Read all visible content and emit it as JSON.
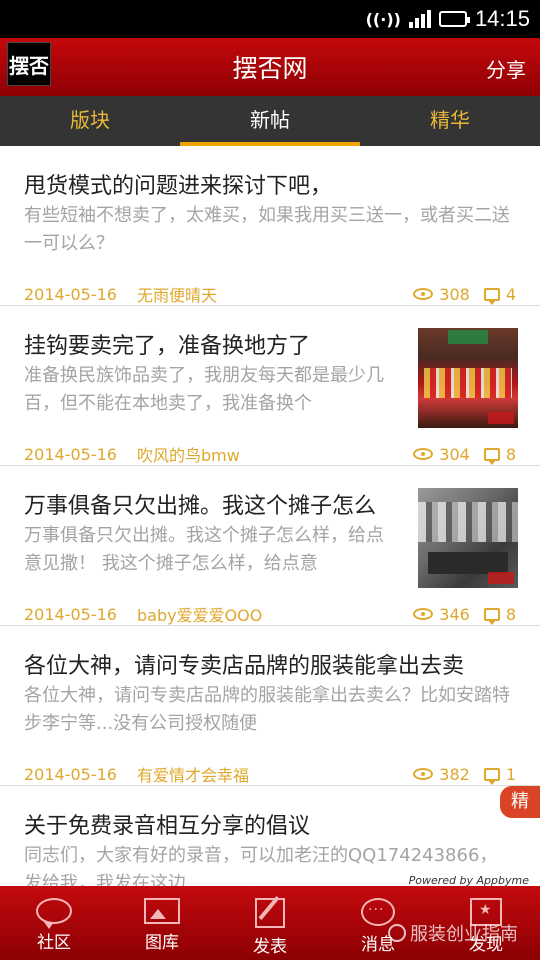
{
  "status_bar": {
    "time": "14:15",
    "vibrate_icon": "vibrate-icon",
    "signal_icon": "signal-icon",
    "battery_icon": "battery-icon"
  },
  "header": {
    "logo_text": "摆否",
    "title": "摆否网",
    "share_label": "分享"
  },
  "tabs": [
    {
      "label": "版块"
    },
    {
      "label": "新帖",
      "active": true
    },
    {
      "label": "精华"
    }
  ],
  "posts": [
    {
      "title": "甩货模式的问题进来探讨下吧，",
      "summary": "有些短袖不想卖了，太难买，如果我用买三送一，或者买二送一可以么？",
      "date": "2014-05-16",
      "author": "无雨便晴天",
      "views": "308",
      "replies": "4"
    },
    {
      "title": "挂钩要卖完了，准备换地方了",
      "summary": "准备换民族饰品卖了，我朋友每天都是最少几百，但不能在本地卖了，我准备换个",
      "date": "2014-05-16",
      "author": "吹风的鸟bmw",
      "views": "304",
      "replies": "8"
    },
    {
      "title": "万事俱备只欠出摊。我这个摊子怎么",
      "summary": "万事俱备只欠出摊。我这个摊子怎么样，给点意见撒！ 我这个摊子怎么样，给点意",
      "date": "2014-05-16",
      "author": "baby爱爱爱OOO",
      "views": "346",
      "replies": "8"
    },
    {
      "title": "各位大神，请问专卖店品牌的服装能拿出去卖",
      "summary": "各位大神，请问专卖店品牌的服装能拿出去卖么？比如安踏特步李宁等...没有公司授权随便",
      "date": "2014-05-16",
      "author": "有爱情才会幸福",
      "views": "382",
      "replies": "1"
    },
    {
      "title": "关于免费录音相互分享的倡议",
      "summary": "同志们，大家有好的录音，可以加老汪的QQ174243866，发给我，我发在这边",
      "badge": "精"
    }
  ],
  "powered_by": "Powered by Appbyme",
  "bottom_nav": [
    {
      "label": "社区",
      "icon": "community-icon"
    },
    {
      "label": "图库",
      "icon": "gallery-icon"
    },
    {
      "label": "发表",
      "icon": "post-icon"
    },
    {
      "label": "消息",
      "icon": "message-icon"
    },
    {
      "label": "发现",
      "icon": "discover-icon"
    }
  ],
  "watermark": "服装创业指南",
  "colors": {
    "brand_red": "#c4080c",
    "tab_gold": "#e6b73a",
    "meta_gold": "#dfa82c",
    "tab_bar": "#343434"
  }
}
